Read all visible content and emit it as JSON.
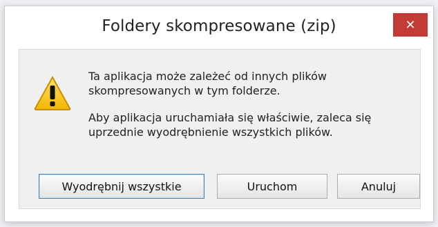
{
  "dialog": {
    "title": "Foldery skompresowane (zip)",
    "close_glyph": "✕",
    "message_line1": "Ta aplikacja może zależeć od innych plików skompresowanych w tym folderze.",
    "message_line2": "Aby aplikacja uruchamiała się właściwie, zaleca się uprzednie wyodrębnienie wszystkich plików.",
    "icon": "warning-icon",
    "buttons": {
      "extract_all": "Wyodrębnij wszystkie",
      "run": "Uruchom",
      "cancel": "Anuluj"
    }
  },
  "colors": {
    "close_button": "#c43a37",
    "warning_fill": "#f7c52b",
    "warning_border": "#d39a00",
    "default_button_border": "#3c7fb1"
  }
}
